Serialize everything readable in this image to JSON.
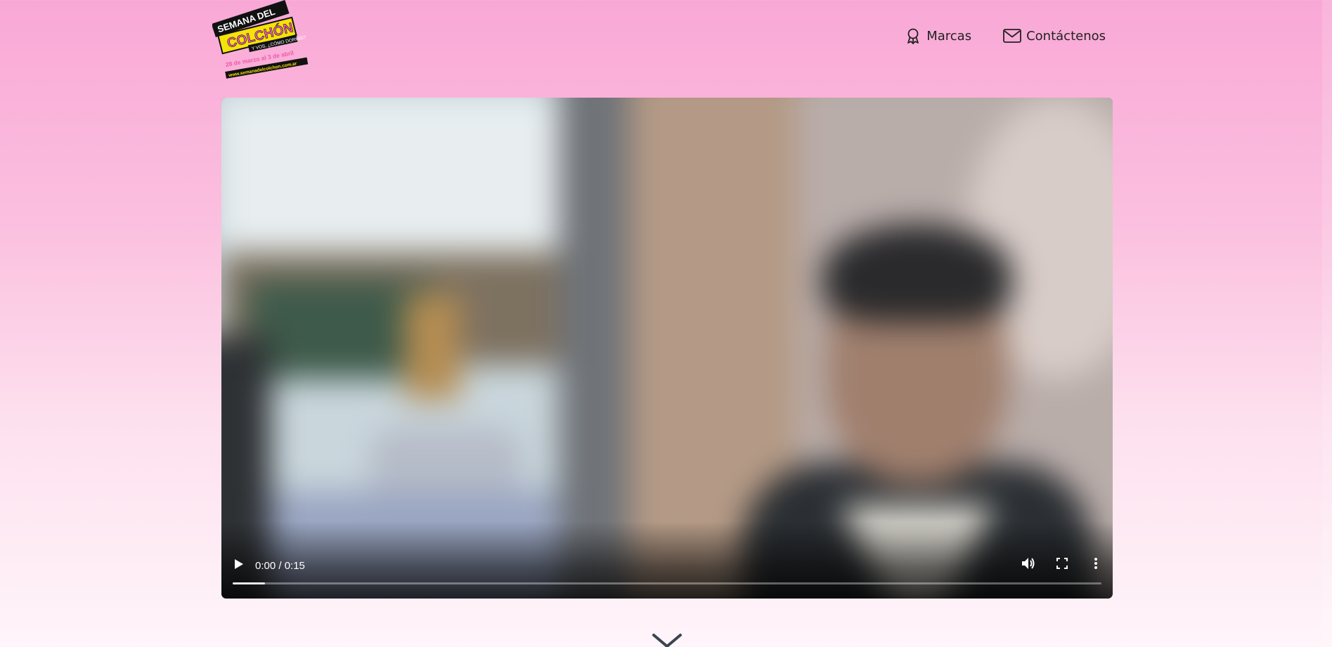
{
  "logo": {
    "line1": "SEMANA DEL",
    "line2": "COLCHÓN",
    "tagline": "Y VOS, ¿CÓMO DORMÍS?",
    "dates": "28 de marzo al 3 de abril",
    "url": "www.semanadelcolchon.com.ar"
  },
  "nav": {
    "items": [
      {
        "label": "Marcas",
        "icon": "ribbon-award-icon"
      },
      {
        "label": "Contáctenos",
        "icon": "envelope-icon"
      }
    ]
  },
  "video": {
    "time_display": "0:00 / 0:15",
    "progress": 0.0,
    "buffered": 0.037,
    "controls": [
      "play-icon",
      "volume-icon",
      "fullscreen-icon",
      "more-options-icon"
    ]
  },
  "colors": {
    "background_top": "#f9a8d6",
    "background_bottom": "#fff5fa",
    "logo_yellow": "#f5e20b",
    "logo_pink": "#f05aa8"
  }
}
